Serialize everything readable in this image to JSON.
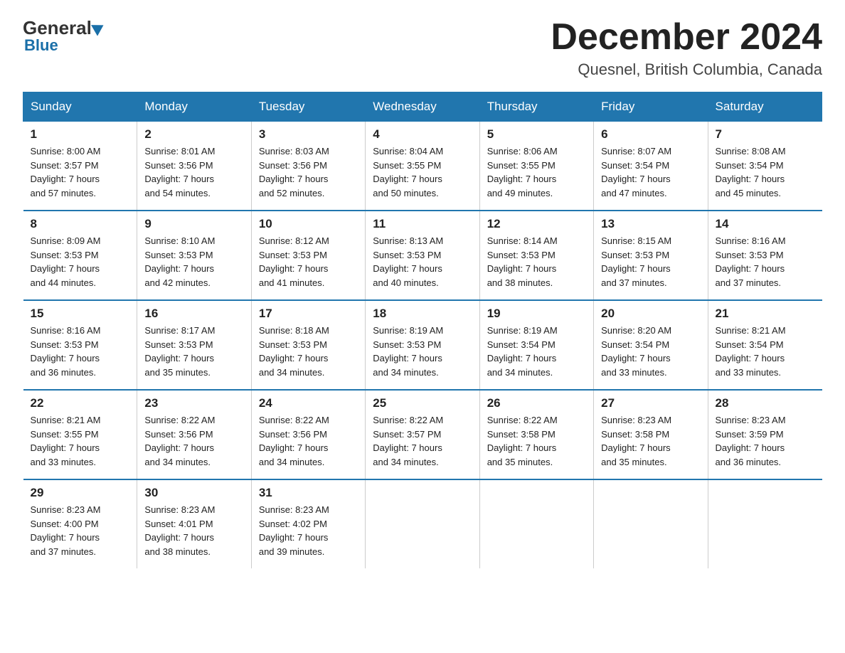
{
  "header": {
    "logo_general": "General",
    "logo_blue": "Blue",
    "title": "December 2024",
    "location": "Quesnel, British Columbia, Canada"
  },
  "weekdays": [
    "Sunday",
    "Monday",
    "Tuesday",
    "Wednesday",
    "Thursday",
    "Friday",
    "Saturday"
  ],
  "weeks": [
    [
      {
        "day": "1",
        "sunrise": "8:00 AM",
        "sunset": "3:57 PM",
        "daylight": "7 hours and 57 minutes."
      },
      {
        "day": "2",
        "sunrise": "8:01 AM",
        "sunset": "3:56 PM",
        "daylight": "7 hours and 54 minutes."
      },
      {
        "day": "3",
        "sunrise": "8:03 AM",
        "sunset": "3:56 PM",
        "daylight": "7 hours and 52 minutes."
      },
      {
        "day": "4",
        "sunrise": "8:04 AM",
        "sunset": "3:55 PM",
        "daylight": "7 hours and 50 minutes."
      },
      {
        "day": "5",
        "sunrise": "8:06 AM",
        "sunset": "3:55 PM",
        "daylight": "7 hours and 49 minutes."
      },
      {
        "day": "6",
        "sunrise": "8:07 AM",
        "sunset": "3:54 PM",
        "daylight": "7 hours and 47 minutes."
      },
      {
        "day": "7",
        "sunrise": "8:08 AM",
        "sunset": "3:54 PM",
        "daylight": "7 hours and 45 minutes."
      }
    ],
    [
      {
        "day": "8",
        "sunrise": "8:09 AM",
        "sunset": "3:53 PM",
        "daylight": "7 hours and 44 minutes."
      },
      {
        "day": "9",
        "sunrise": "8:10 AM",
        "sunset": "3:53 PM",
        "daylight": "7 hours and 42 minutes."
      },
      {
        "day": "10",
        "sunrise": "8:12 AM",
        "sunset": "3:53 PM",
        "daylight": "7 hours and 41 minutes."
      },
      {
        "day": "11",
        "sunrise": "8:13 AM",
        "sunset": "3:53 PM",
        "daylight": "7 hours and 40 minutes."
      },
      {
        "day": "12",
        "sunrise": "8:14 AM",
        "sunset": "3:53 PM",
        "daylight": "7 hours and 38 minutes."
      },
      {
        "day": "13",
        "sunrise": "8:15 AM",
        "sunset": "3:53 PM",
        "daylight": "7 hours and 37 minutes."
      },
      {
        "day": "14",
        "sunrise": "8:16 AM",
        "sunset": "3:53 PM",
        "daylight": "7 hours and 37 minutes."
      }
    ],
    [
      {
        "day": "15",
        "sunrise": "8:16 AM",
        "sunset": "3:53 PM",
        "daylight": "7 hours and 36 minutes."
      },
      {
        "day": "16",
        "sunrise": "8:17 AM",
        "sunset": "3:53 PM",
        "daylight": "7 hours and 35 minutes."
      },
      {
        "day": "17",
        "sunrise": "8:18 AM",
        "sunset": "3:53 PM",
        "daylight": "7 hours and 34 minutes."
      },
      {
        "day": "18",
        "sunrise": "8:19 AM",
        "sunset": "3:53 PM",
        "daylight": "7 hours and 34 minutes."
      },
      {
        "day": "19",
        "sunrise": "8:19 AM",
        "sunset": "3:54 PM",
        "daylight": "7 hours and 34 minutes."
      },
      {
        "day": "20",
        "sunrise": "8:20 AM",
        "sunset": "3:54 PM",
        "daylight": "7 hours and 33 minutes."
      },
      {
        "day": "21",
        "sunrise": "8:21 AM",
        "sunset": "3:54 PM",
        "daylight": "7 hours and 33 minutes."
      }
    ],
    [
      {
        "day": "22",
        "sunrise": "8:21 AM",
        "sunset": "3:55 PM",
        "daylight": "7 hours and 33 minutes."
      },
      {
        "day": "23",
        "sunrise": "8:22 AM",
        "sunset": "3:56 PM",
        "daylight": "7 hours and 34 minutes."
      },
      {
        "day": "24",
        "sunrise": "8:22 AM",
        "sunset": "3:56 PM",
        "daylight": "7 hours and 34 minutes."
      },
      {
        "day": "25",
        "sunrise": "8:22 AM",
        "sunset": "3:57 PM",
        "daylight": "7 hours and 34 minutes."
      },
      {
        "day": "26",
        "sunrise": "8:22 AM",
        "sunset": "3:58 PM",
        "daylight": "7 hours and 35 minutes."
      },
      {
        "day": "27",
        "sunrise": "8:23 AM",
        "sunset": "3:58 PM",
        "daylight": "7 hours and 35 minutes."
      },
      {
        "day": "28",
        "sunrise": "8:23 AM",
        "sunset": "3:59 PM",
        "daylight": "7 hours and 36 minutes."
      }
    ],
    [
      {
        "day": "29",
        "sunrise": "8:23 AM",
        "sunset": "4:00 PM",
        "daylight": "7 hours and 37 minutes."
      },
      {
        "day": "30",
        "sunrise": "8:23 AM",
        "sunset": "4:01 PM",
        "daylight": "7 hours and 38 minutes."
      },
      {
        "day": "31",
        "sunrise": "8:23 AM",
        "sunset": "4:02 PM",
        "daylight": "7 hours and 39 minutes."
      },
      null,
      null,
      null,
      null
    ]
  ],
  "labels": {
    "sunrise": "Sunrise:",
    "sunset": "Sunset:",
    "daylight": "Daylight:"
  }
}
